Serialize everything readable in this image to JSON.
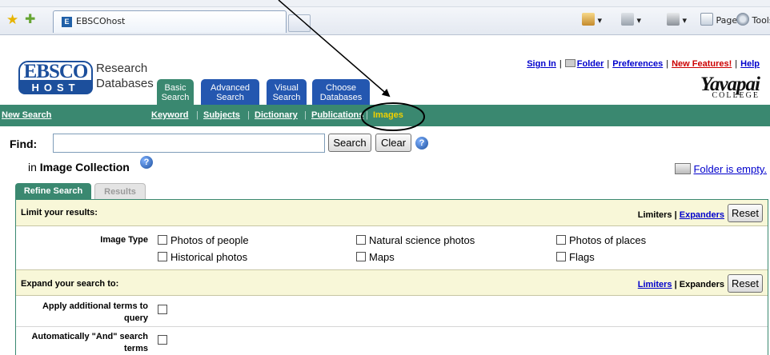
{
  "browser": {
    "tab_title": "EBSCOhost",
    "tab_favicon": "E",
    "command_bar": {
      "page_label": "Page",
      "tools_label": "Tools"
    }
  },
  "logo": {
    "top": "EBSCO",
    "bottom": "HOST",
    "line1": "Research",
    "line2": "Databases"
  },
  "nav_tabs": [
    {
      "line1": "Basic",
      "line2": "Search"
    },
    {
      "line1": "Advanced",
      "line2": "Search"
    },
    {
      "line1": "Visual",
      "line2": "Search"
    },
    {
      "line1": "Choose",
      "line2": "Databases"
    }
  ],
  "top_links": {
    "sign_in": "Sign In",
    "folder": "Folder",
    "preferences": "Preferences",
    "new_features": "New Features!",
    "help": "Help"
  },
  "college": {
    "name": "Yavapai",
    "sub": "COLLEGE"
  },
  "subnav": {
    "new_search": "New Search",
    "keyword": "Keyword",
    "subjects": "Subjects",
    "dictionary": "Dictionary",
    "publications": "Publications",
    "images": "Images"
  },
  "find": {
    "label": "Find:",
    "value": "",
    "search_button": "Search",
    "clear_button": "Clear"
  },
  "collection": {
    "prefix": "in",
    "name": "Image Collection"
  },
  "folder_status": "Folder is empty.",
  "refine_tabs": [
    "Refine Search",
    "Results"
  ],
  "limit": {
    "title": "Limit your results:",
    "limiters": "Limiters",
    "expanders": "Expanders",
    "reset": "Reset",
    "image_type_label": "Image Type",
    "options": [
      "Photos of people",
      "Natural science photos",
      "Photos of places",
      "Historical photos",
      "Maps",
      "Flags"
    ]
  },
  "expand": {
    "title": "Expand your search to:",
    "limiters": "Limiters",
    "expanders": "Expanders",
    "reset": "Reset",
    "option1": "Apply additional terms to query",
    "option2": "Automatically \"And\" search terms"
  },
  "colors": {
    "ebsco_blue": "#1c4f9c",
    "green_bar": "#3a8870",
    "band": "#f8f7d8",
    "new_features_red": "#cc0000"
  }
}
